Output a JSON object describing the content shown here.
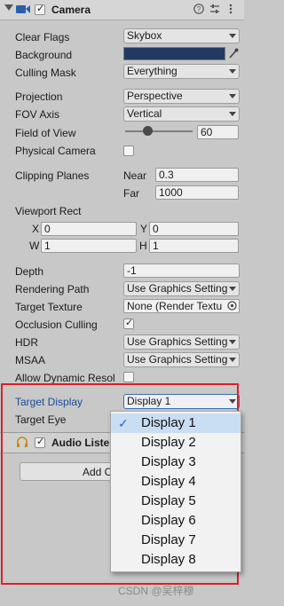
{
  "camera": {
    "title": "Camera",
    "header_icons": [
      "help-icon",
      "presets-icon",
      "more-icon"
    ],
    "clear_flags": {
      "label": "Clear Flags",
      "value": "Skybox"
    },
    "background": {
      "label": "Background",
      "color": "#223a62"
    },
    "culling_mask": {
      "label": "Culling Mask",
      "value": "Everything"
    },
    "projection": {
      "label": "Projection",
      "value": "Perspective"
    },
    "fov_axis": {
      "label": "FOV Axis",
      "value": "Vertical"
    },
    "field_of_view": {
      "label": "Field of View",
      "value": "60",
      "slider_fraction": 0.33
    },
    "physical_camera": {
      "label": "Physical Camera",
      "checked": false
    },
    "clipping_planes": {
      "label": "Clipping Planes",
      "near_label": "Near",
      "near": "0.3",
      "far_label": "Far",
      "far": "1000"
    },
    "viewport_rect": {
      "label": "Viewport Rect",
      "x_label": "X",
      "x": "0",
      "y_label": "Y",
      "y": "0",
      "w_label": "W",
      "w": "1",
      "h_label": "H",
      "h": "1"
    },
    "depth": {
      "label": "Depth",
      "value": "-1"
    },
    "rendering_path": {
      "label": "Rendering Path",
      "value": "Use Graphics Setting"
    },
    "target_texture": {
      "label": "Target Texture",
      "value": "None (Render Textu"
    },
    "occlusion_culling": {
      "label": "Occlusion Culling",
      "checked": true
    },
    "hdr": {
      "label": "HDR",
      "value": "Use Graphics Setting"
    },
    "msaa": {
      "label": "MSAA",
      "value": "Use Graphics Setting"
    },
    "allow_dynamic_resolution": {
      "label": "Allow Dynamic Resol",
      "checked": false
    },
    "target_display": {
      "label": "Target Display",
      "value": "Display 1"
    },
    "target_eye": {
      "label": "Target Eye"
    }
  },
  "audio_listener": {
    "title": "Audio Liste"
  },
  "add_component": {
    "label": "Add C"
  },
  "display_menu": {
    "selected": "Display 1",
    "items": [
      "Display 1",
      "Display 2",
      "Display 3",
      "Display 4",
      "Display 5",
      "Display 6",
      "Display 7",
      "Display 8"
    ]
  },
  "watermark": "CSDN @吴梓穆",
  "colors": {
    "highlight": "#e0202a",
    "label_blue": "#1b4b9a"
  }
}
